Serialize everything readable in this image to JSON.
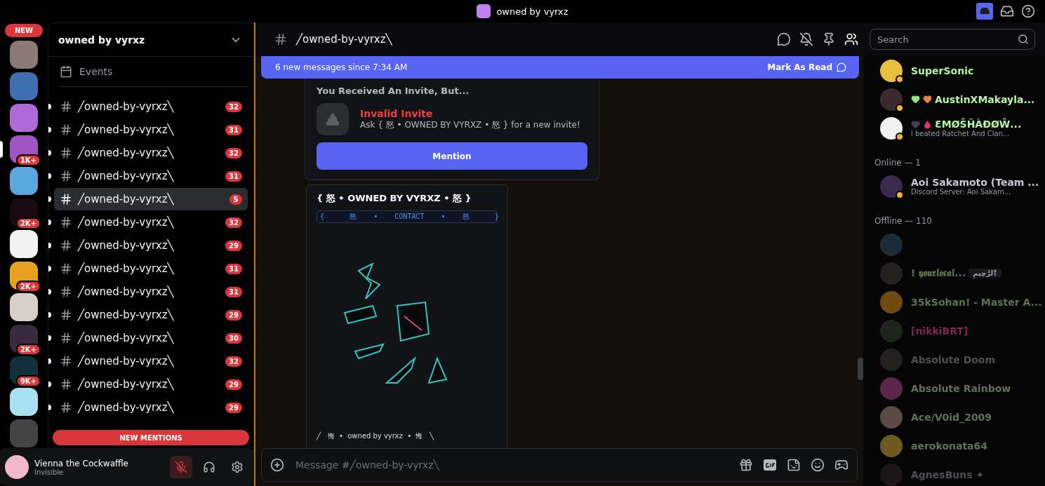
{
  "title_bar": {
    "title": "owned by vyrxz"
  },
  "servers": [
    {
      "kind": "new",
      "badge": "NEW"
    },
    {
      "kind": "icon"
    },
    {
      "kind": "icon"
    },
    {
      "kind": "icon"
    },
    {
      "kind": "icon",
      "badge": "1K+",
      "selected": true
    },
    {
      "kind": "icon",
      "selected": false
    },
    {
      "kind": "icon",
      "badge": "2K+",
      "selected": false
    },
    {
      "kind": "icon",
      "selected": false
    },
    {
      "kind": "icon",
      "badge": "2K+",
      "selected": false
    },
    {
      "kind": "icon",
      "selected": false
    },
    {
      "kind": "icon",
      "badge": "2K+",
      "selected": false
    },
    {
      "kind": "icon",
      "badge": "9K+",
      "selected": false
    },
    {
      "kind": "icon",
      "selected": false
    },
    {
      "kind": "icon",
      "selected": false
    }
  ],
  "sidebar": {
    "server_name": "owned by vyrxz",
    "events": "Events",
    "new_mentions": "NEW MENTIONS",
    "channels": [
      {
        "name": "╱owned-by-vyrxz╲",
        "count": "32",
        "selected": false
      },
      {
        "name": "╱owned-by-vyrxz╲",
        "count": "31",
        "selected": false
      },
      {
        "name": "╱owned-by-vyrxz╲",
        "count": "32",
        "selected": false
      },
      {
        "name": "╱owned-by-vyrxz╲",
        "count": "31",
        "selected": false
      },
      {
        "name": "╱owned-by-vyrxz╲",
        "count": "5",
        "selected": true
      },
      {
        "name": "╱owned-by-vyrxz╲",
        "count": "32",
        "selected": false
      },
      {
        "name": "╱owned-by-vyrxz╲",
        "count": "29",
        "selected": false
      },
      {
        "name": "╱owned-by-vyrxz╲",
        "count": "31",
        "selected": false
      },
      {
        "name": "╱owned-by-vyrxz╲",
        "count": "31",
        "selected": false
      },
      {
        "name": "╱owned-by-vyrxz╲",
        "count": "29",
        "selected": false
      },
      {
        "name": "╱owned-by-vyrxz╲",
        "count": "30",
        "selected": false
      },
      {
        "name": "╱owned-by-vyrxz╲",
        "count": "32",
        "selected": false
      },
      {
        "name": "╱owned-by-vyrxz╲",
        "count": "29",
        "selected": false
      },
      {
        "name": "╱owned-by-vyrxz╲",
        "count": "29",
        "selected": false
      }
    ]
  },
  "user_panel": {
    "name": "Vienna the Cockwaffle",
    "status": "Invisible",
    "muted": true
  },
  "header": {
    "channel": "╱owned-by-vyrxz╲",
    "search_placeholder": "Search",
    "members_open": true
  },
  "banner": {
    "text": "6 new messages since 7:34 AM",
    "action": "Mark As Read"
  },
  "invite": {
    "heading": "You Received An Invite, But...",
    "title": "Invalid Invite",
    "text": "Ask { 怒 • OWNED BY VYRXZ • 怒 } for a new invite!",
    "button": "Mention"
  },
  "embed": {
    "title": "{ 怒 • OWNED BY VYRXZ • 怒 }",
    "code": "{      怒    •    CONTACT    •    怒      }",
    "footer": "╱   悔  •  owned by vyrxz  •  悔   ╲"
  },
  "composer": {
    "placeholder": "Message #╱owned-by-vyrxz╲"
  },
  "members": [
    {
      "kind": "member",
      "name": "SuperSonic",
      "color": "#b5f5a0",
      "offline": false
    },
    {
      "kind": "member_hearts",
      "name": "AustinXMakayla...",
      "color": "#b5f5a0",
      "offline": false
    },
    {
      "kind": "member_heart_drop",
      "name": "ƐMØŠĤÀĐØŴ...",
      "status": "i beated Ratchet And Clan...",
      "color": "#b5f5a0",
      "offline": false
    },
    {
      "kind": "heading",
      "name": "Online — 1"
    },
    {
      "kind": "member",
      "name": "Aoi Sakamoto (Team ...",
      "status": "Discord Server: Aoi Sakam...",
      "color": "#c9c9d2",
      "offline": false
    },
    {
      "kind": "heading",
      "name": "Offline — 110"
    },
    {
      "kind": "member",
      "offline": true
    },
    {
      "kind": "member",
      "name": "! 𝖞𝖔𝖚𝖗𝖑𝖔𝖈𝖆𝖑...",
      "tag": "ٱلرَّحِيمِ",
      "color": "#5f7257",
      "offline": true
    },
    {
      "kind": "member",
      "name": "35kSohan! - Master A...",
      "color": "#5f7257",
      "offline": true
    },
    {
      "kind": "member",
      "name": "[nikkiBRT]",
      "color": "#7a2a4e",
      "offline": true
    },
    {
      "kind": "member",
      "name": "Absolute Doom",
      "color": "#4e5056",
      "offline": true
    },
    {
      "kind": "member",
      "name": "Absolute Rainbow",
      "color": "#5f7257",
      "offline": true
    },
    {
      "kind": "member",
      "name": "Ace/V0id_2009",
      "color": "#5f7257",
      "offline": true
    },
    {
      "kind": "member",
      "name": "aerokonata64",
      "color": "#5f7257",
      "offline": true
    },
    {
      "kind": "member",
      "name": "AgnesBuns ✦",
      "color": "#4e5056",
      "offline": true
    }
  ]
}
